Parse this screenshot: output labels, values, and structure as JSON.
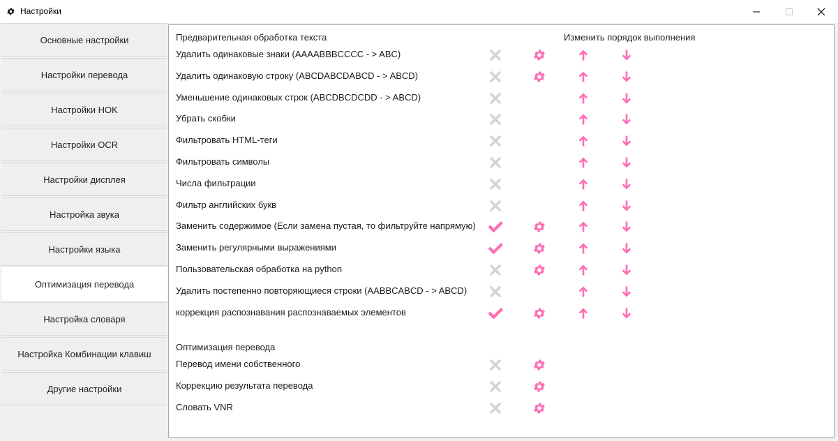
{
  "window": {
    "title": "Настройки",
    "icon": "gear-icon",
    "controls": [
      "minimize-icon",
      "maximize-icon",
      "close-icon"
    ]
  },
  "colors": {
    "accent": "#ff6eb4",
    "disabled": "#d4d4d4",
    "sidebar_bg": "#efefef",
    "panel_bg": "#ffffff"
  },
  "sidebar": {
    "active_index": 7,
    "items": [
      {
        "label": "Основные настройки"
      },
      {
        "label": "Настройки перевода"
      },
      {
        "label": "Настройки HOK"
      },
      {
        "label": "Настройки OCR"
      },
      {
        "label": "Настройки дисплея"
      },
      {
        "label": "Настройка звука"
      },
      {
        "label": "Настройки языка"
      },
      {
        "label": "Оптимизация перевода"
      },
      {
        "label": "Настройка словаря"
      },
      {
        "label": "Настройка Комбинации клавиш"
      },
      {
        "label": "Другие настройки"
      }
    ]
  },
  "preprocessing": {
    "title": "Предварительная обработка текста",
    "order_header": "Изменить порядок выполнения",
    "items": [
      {
        "label": "Удалить одинаковые знаки (AAAABBBCCCC - > ABC)",
        "enabled": false,
        "settings": true
      },
      {
        "label": "Удалить одинаковую строку (ABCDABCDABCD - > ABCD)",
        "enabled": false,
        "settings": true
      },
      {
        "label": "Уменьшение одинаковых строк (ABCDBCDCDD - > ABCD)",
        "enabled": false,
        "settings": false
      },
      {
        "label": "Убрать скобки",
        "enabled": false,
        "settings": false
      },
      {
        "label": "Фильтровать HTML-теги",
        "enabled": false,
        "settings": false
      },
      {
        "label": "Фильтровать символы",
        "enabled": false,
        "settings": false
      },
      {
        "label": "Числа фильтрации",
        "enabled": false,
        "settings": false
      },
      {
        "label": "Фильтр английских букв",
        "enabled": false,
        "settings": false
      },
      {
        "label": "Заменить содержимое (Если замена пустая, то фильтруйте напрямую)",
        "enabled": true,
        "settings": true
      },
      {
        "label": "Заменить регулярными выражениями",
        "enabled": true,
        "settings": true
      },
      {
        "label": "Пользовательская обработка на python",
        "enabled": false,
        "settings": true
      },
      {
        "label": "Удалить постепенно повторяющиеся строки (AABBCABCD - > ABCD)",
        "enabled": false,
        "settings": false
      },
      {
        "label": "коррекция распознавания распознаваемых элементов",
        "enabled": true,
        "settings": true
      }
    ]
  },
  "optimization": {
    "title": "Оптимизация перевода",
    "items": [
      {
        "label": "Перевод имени собственного",
        "enabled": false,
        "settings": true
      },
      {
        "label": "Коррекцию результата перевода",
        "enabled": false,
        "settings": true
      },
      {
        "label": "Словать VNR",
        "enabled": false,
        "settings": true
      }
    ]
  }
}
